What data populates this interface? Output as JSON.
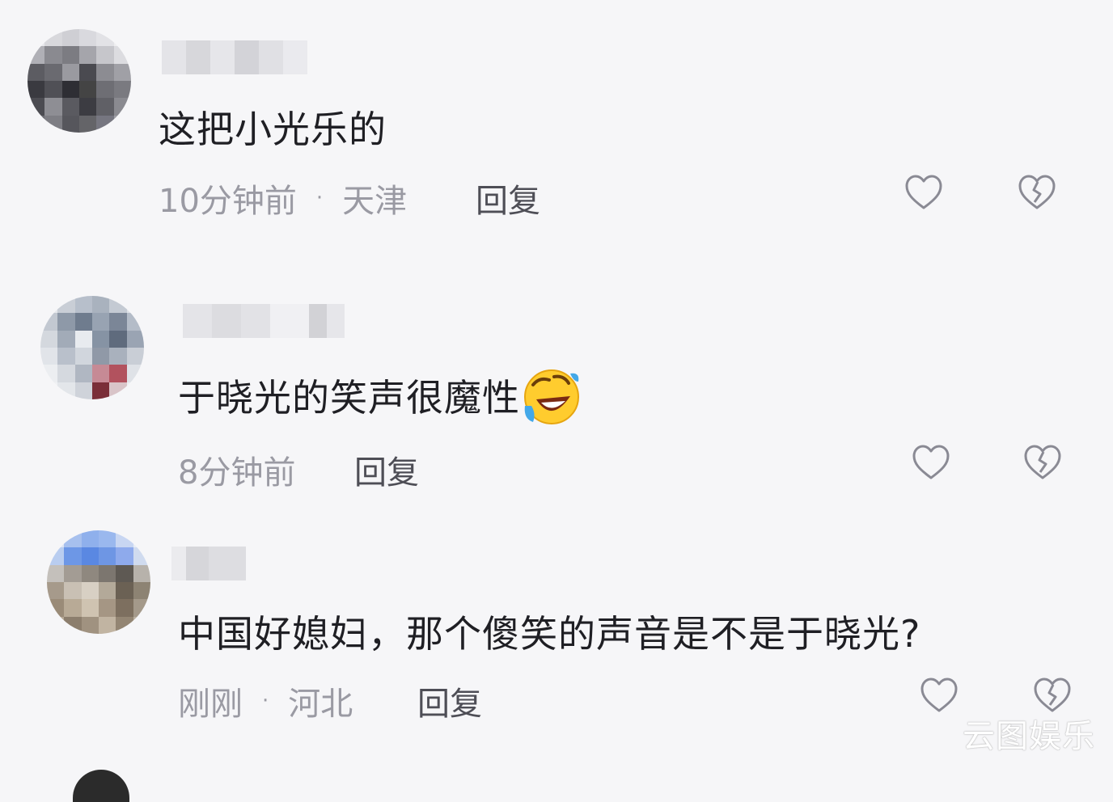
{
  "comments": [
    {
      "text": "这把小光乐的",
      "time": "10分钟前",
      "separator": "·",
      "location": "天津",
      "reply_label": "回复",
      "has_emoji": false
    },
    {
      "text": "于晓光的笑声很魔性",
      "time": "8分钟前",
      "separator": "",
      "location": "",
      "reply_label": "回复",
      "has_emoji": true,
      "emoji": "rolling-on-floor-laughing"
    },
    {
      "text": "中国好媳妇，那个傻笑的声音是不是于晓光?",
      "time": "刚刚",
      "separator": "·",
      "location": "河北",
      "reply_label": "回复",
      "has_emoji": false
    }
  ],
  "icons": {
    "like": "heart-icon",
    "dislike": "broken-heart-icon"
  },
  "watermark": "云图娱乐",
  "colors": {
    "background": "#f6f6f8",
    "text": "#1f1f24",
    "meta": "#9a9aa3",
    "reply": "#4e4e56",
    "icon_stroke": "#8a8a94"
  }
}
